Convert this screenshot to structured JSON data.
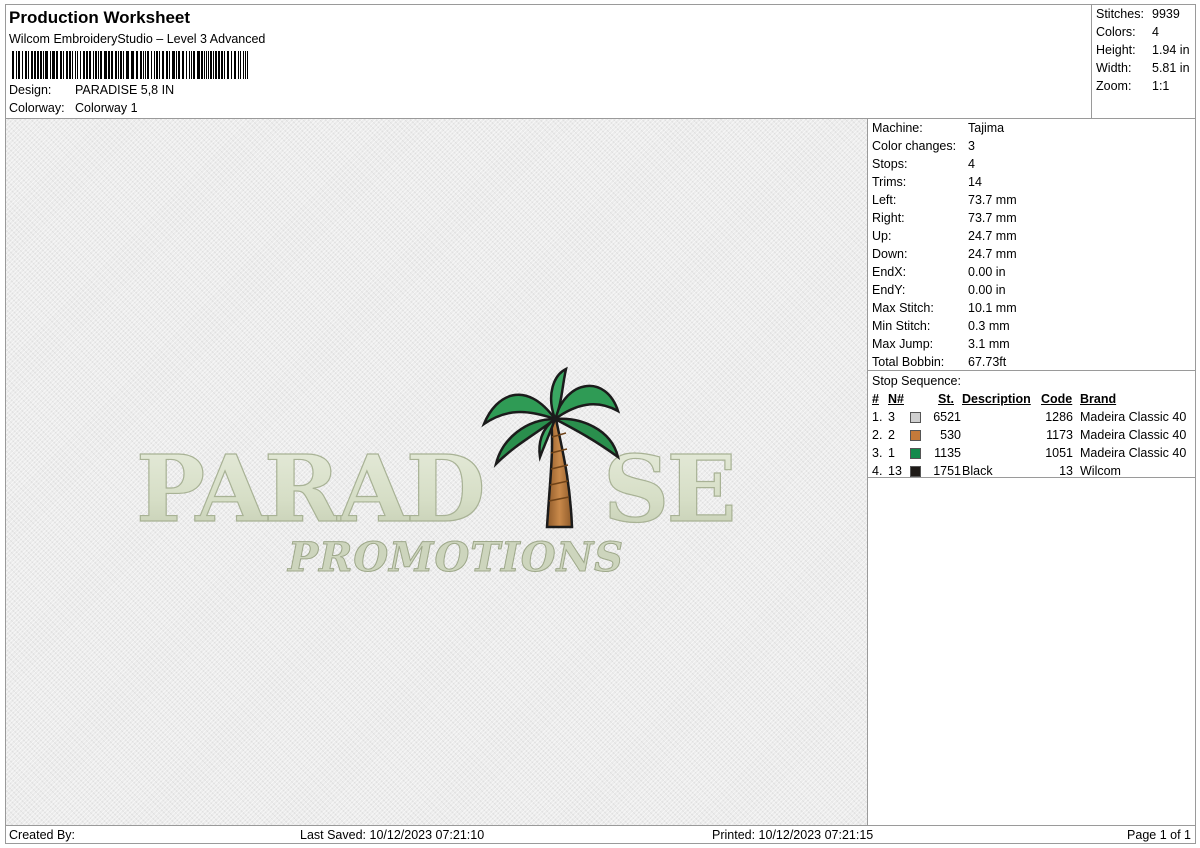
{
  "header": {
    "title": "Production Worksheet",
    "subtitle": "Wilcom EmbroideryStudio – Level 3 Advanced",
    "design_label": "Design:",
    "design_value": "PARADISE 5,8 IN",
    "colorway_label": "Colorway:",
    "colorway_value": "Colorway 1"
  },
  "summary": {
    "stitches_label": "Stitches:",
    "stitches_value": "9939",
    "colors_label": "Colors:",
    "colors_value": "4",
    "height_label": "Height:",
    "height_value": "1.94 in",
    "width_label": "Width:",
    "width_value": "5.81 in",
    "zoom_label": "Zoom:",
    "zoom_value": "1:1"
  },
  "design_art": {
    "word_main": "PARADISE",
    "word_sub": "PROMOTIONS",
    "thread_light": "#dfe6d2",
    "thread_green": "#2e9b55",
    "thread_brown": "#b97a3f",
    "thread_black": "#1b1b1b"
  },
  "machine": {
    "rows": [
      {
        "label": "Machine:",
        "value": "Tajima"
      },
      {
        "label": "Color changes:",
        "value": "3"
      },
      {
        "label": "Stops:",
        "value": "4"
      },
      {
        "label": "Trims:",
        "value": "14"
      },
      {
        "label": "Left:",
        "value": "73.7 mm"
      },
      {
        "label": "Right:",
        "value": "73.7 mm"
      },
      {
        "label": "Up:",
        "value": "24.7 mm"
      },
      {
        "label": "Down:",
        "value": "24.7 mm"
      },
      {
        "label": "EndX:",
        "value": "0.00 in"
      },
      {
        "label": "EndY:",
        "value": "0.00 in"
      },
      {
        "label": "Max Stitch:",
        "value": "10.1 mm"
      },
      {
        "label": "Min Stitch:",
        "value": "0.3 mm"
      },
      {
        "label": "Max Jump:",
        "value": "3.1 mm"
      },
      {
        "label": "Total Bobbin:",
        "value": "67.73ft"
      }
    ]
  },
  "stop_sequence": {
    "title": "Stop Sequence:",
    "headers": {
      "idx": "#",
      "n": "N#",
      "st": "St.",
      "desc": "Description",
      "code": "Code",
      "brand": "Brand"
    },
    "rows": [
      {
        "idx": "1.",
        "n": "3",
        "color": "#cfcfcf",
        "st": "6521",
        "desc": "",
        "code": "1286",
        "brand": "Madeira Classic 40"
      },
      {
        "idx": "2.",
        "n": "2",
        "color": "#c47a3a",
        "st": "530",
        "desc": "",
        "code": "1173",
        "brand": "Madeira Classic 40"
      },
      {
        "idx": "3.",
        "n": "1",
        "color": "#138a4c",
        "st": "1135",
        "desc": "",
        "code": "1051",
        "brand": "Madeira Classic 40"
      },
      {
        "idx": "4.",
        "n": "13",
        "color": "#1e1a17",
        "st": "1751",
        "desc": "Black",
        "code": "13",
        "brand": "Wilcom"
      }
    ]
  },
  "footer": {
    "created_by": "Created By:",
    "last_saved": "Last Saved: 10/12/2023 07:21:10",
    "printed": "Printed: 10/12/2023 07:21:15",
    "page": "Page 1 of 1"
  }
}
